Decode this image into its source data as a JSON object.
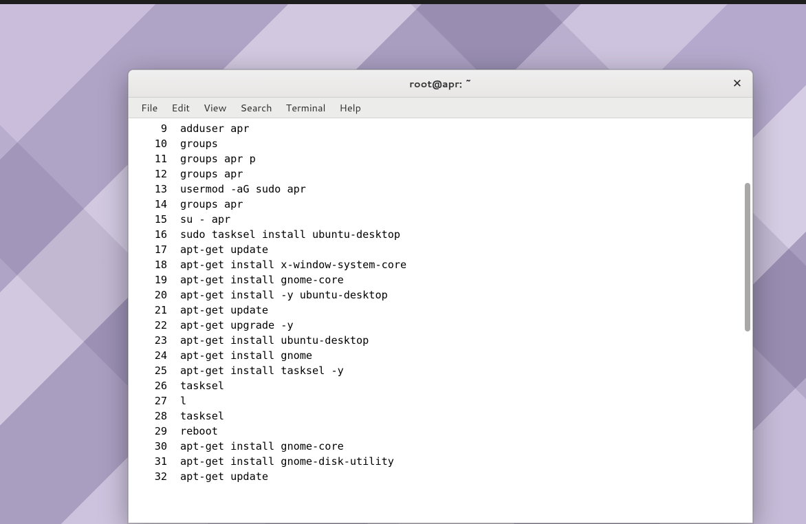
{
  "window": {
    "title": "root@apr: ~"
  },
  "menubar": {
    "items": [
      {
        "label": "File"
      },
      {
        "label": "Edit"
      },
      {
        "label": "View"
      },
      {
        "label": "Search"
      },
      {
        "label": "Terminal"
      },
      {
        "label": "Help"
      }
    ]
  },
  "close_glyph": "✕",
  "history": [
    {
      "n": "9",
      "cmd": "adduser apr"
    },
    {
      "n": "10",
      "cmd": "groups"
    },
    {
      "n": "11",
      "cmd": "groups apr p"
    },
    {
      "n": "12",
      "cmd": "groups apr"
    },
    {
      "n": "13",
      "cmd": "usermod -aG sudo apr"
    },
    {
      "n": "14",
      "cmd": "groups apr"
    },
    {
      "n": "15",
      "cmd": "su - apr"
    },
    {
      "n": "16",
      "cmd": "sudo tasksel install ubuntu-desktop"
    },
    {
      "n": "17",
      "cmd": "apt-get update"
    },
    {
      "n": "18",
      "cmd": "apt-get install x-window-system-core"
    },
    {
      "n": "19",
      "cmd": "apt-get install gnome-core"
    },
    {
      "n": "20",
      "cmd": "apt-get install -y ubuntu-desktop"
    },
    {
      "n": "21",
      "cmd": "apt-get update"
    },
    {
      "n": "22",
      "cmd": "apt-get upgrade -y"
    },
    {
      "n": "23",
      "cmd": "apt-get install ubuntu-desktop"
    },
    {
      "n": "24",
      "cmd": "apt-get install gnome"
    },
    {
      "n": "25",
      "cmd": "apt-get install tasksel -y"
    },
    {
      "n": "26",
      "cmd": "tasksel"
    },
    {
      "n": "27",
      "cmd": "l"
    },
    {
      "n": "28",
      "cmd": "tasksel"
    },
    {
      "n": "29",
      "cmd": "reboot"
    },
    {
      "n": "30",
      "cmd": "apt-get install gnome-core"
    },
    {
      "n": "31",
      "cmd": "apt-get install gnome-disk-utility"
    },
    {
      "n": "32",
      "cmd": "apt-get update"
    }
  ]
}
